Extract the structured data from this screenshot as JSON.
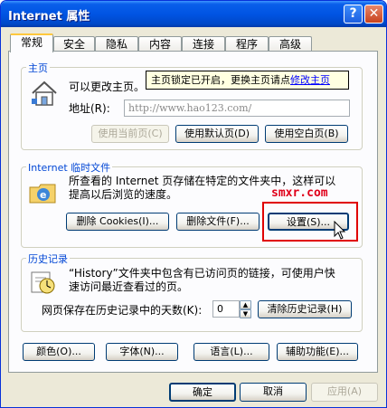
{
  "window": {
    "title": "Internet 属性",
    "help_glyph": "?",
    "close_glyph": "✕"
  },
  "tabs": [
    {
      "label": "常规",
      "active": true
    },
    {
      "label": "安全"
    },
    {
      "label": "隐私"
    },
    {
      "label": "内容"
    },
    {
      "label": "连接"
    },
    {
      "label": "程序"
    },
    {
      "label": "高级"
    }
  ],
  "homepage": {
    "legend": "主页",
    "description": "可以更改主页。",
    "tooltip_text": "主页锁定已开启，更换主页请点",
    "tooltip_link": "修改主页",
    "address_label": "地址(R):",
    "address_value": "http://www.hao123.com/",
    "buttons": {
      "use_current": "使用当前页(C)",
      "use_default": "使用默认页(D)",
      "use_blank": "使用空白页(B)"
    }
  },
  "temp_files": {
    "legend": "Internet 临时文件",
    "description_line1": "所查看的 Internet 页存储在特定的文件夹中，这样可以",
    "description_line2": "提高以后浏览的速度。",
    "watermark": "smxr.com",
    "buttons": {
      "delete_cookies": "删除 Cookies(I)...",
      "delete_files": "删除文件(F)...",
      "settings": "设置(S)..."
    }
  },
  "history": {
    "legend": "历史记录",
    "description_line1": "“History”文件夹中包含有已访问页的链接，可使用户快",
    "description_line2": "速访问最近查看过的页。",
    "days_label": "网页保存在历史记录中的天数(K):",
    "days_value": "0",
    "clear_button": "清除历史记录(H)"
  },
  "bottom_buttons": {
    "colors": "颜色(O)...",
    "fonts": "字体(N)...",
    "languages": "语言(L)...",
    "accessibility": "辅助功能(E)..."
  },
  "dialog_buttons": {
    "ok": "确定",
    "cancel": "取消",
    "apply": "应用(A)"
  },
  "colors": {
    "titlebar": "#0054E3",
    "legend": "#0046D5",
    "highlight_box": "#E00000"
  }
}
